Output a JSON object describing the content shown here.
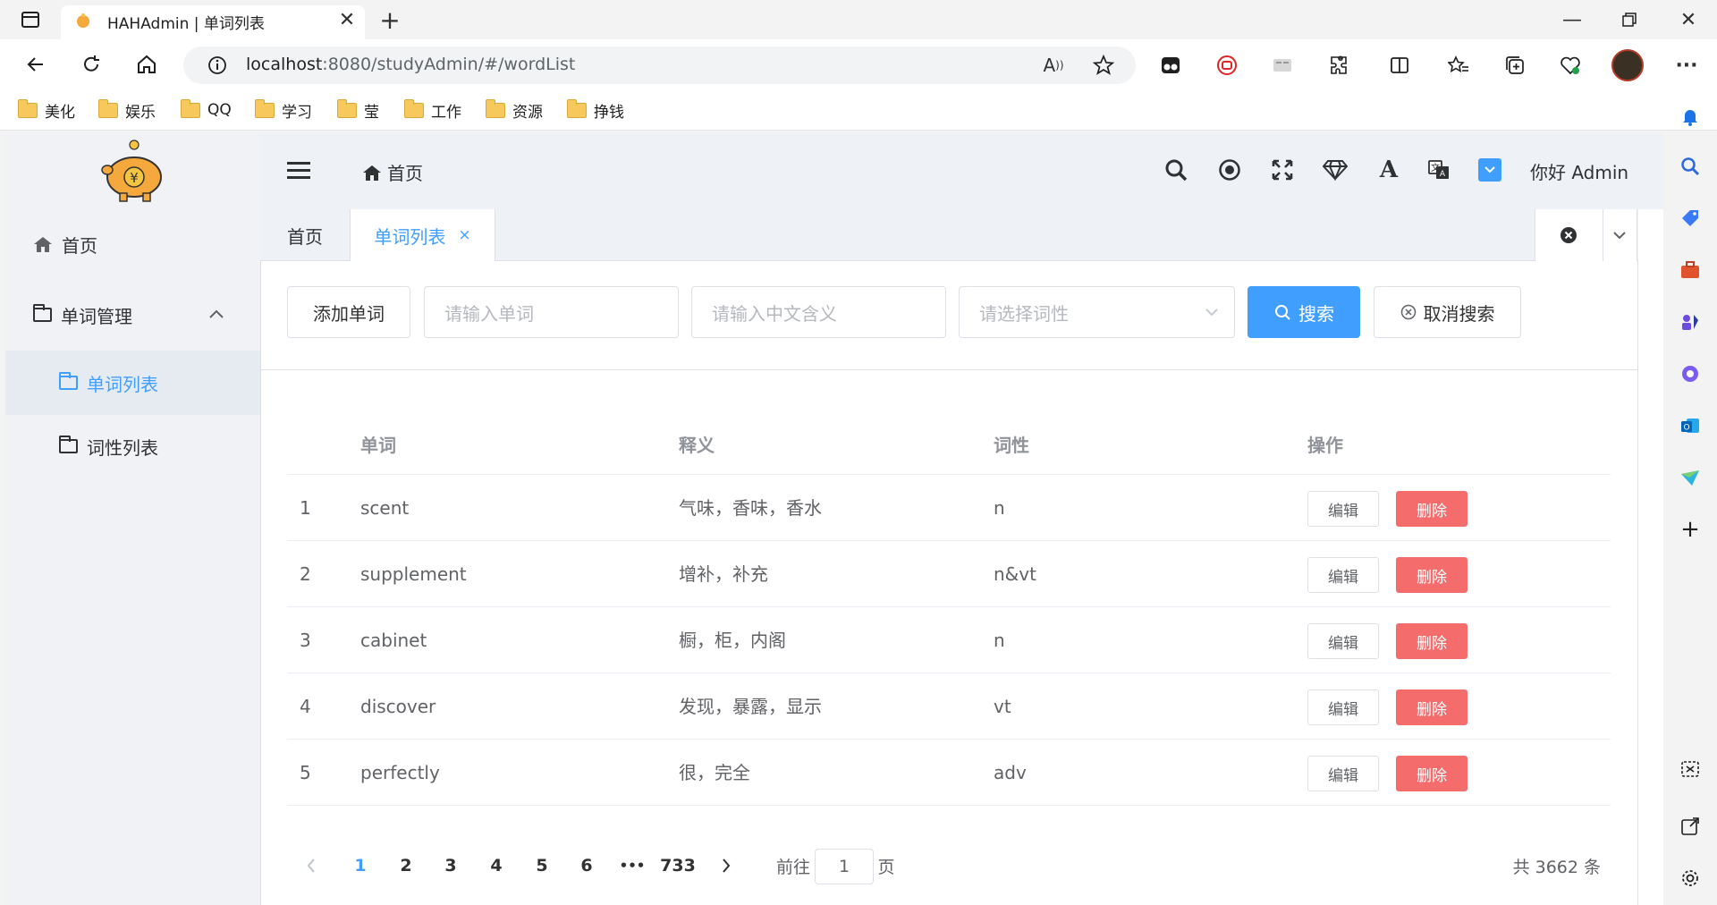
{
  "browser": {
    "tab_title": "HAHAdmin | 单词列表",
    "url_host": "localhost",
    "url_rest": ":8080/studyAdmin/#/wordList",
    "bookmarks": [
      "美化",
      "娱乐",
      "QQ",
      "学习",
      "莹",
      "工作",
      "资源",
      "挣钱"
    ]
  },
  "sidebar": {
    "logo_icon": "piggy-bank-icon",
    "items": [
      {
        "label": "首页",
        "icon": "home-icon"
      },
      {
        "label": "单词管理",
        "icon": "folder-icon"
      },
      {
        "label": "单词列表",
        "icon": "folder-icon",
        "active": true
      },
      {
        "label": "词性列表",
        "icon": "folder-icon"
      }
    ]
  },
  "header": {
    "breadcrumb": "首页",
    "greeting": "你好 Admin"
  },
  "tabs": [
    {
      "label": "首页"
    },
    {
      "label": "单词列表",
      "close": "×",
      "active": true
    }
  ],
  "filters": {
    "add_button": "添加单词",
    "word_placeholder": "请输入单词",
    "meaning_placeholder": "请输入中文含义",
    "pos_placeholder": "请选择词性",
    "search_button": "搜索",
    "cancel_button": "取消搜索"
  },
  "table": {
    "columns": [
      "单词",
      "释义",
      "词性",
      "操作"
    ],
    "rows": [
      {
        "index": "1",
        "word": "scent",
        "meaning": "气味，香味，香水",
        "pos": "n"
      },
      {
        "index": "2",
        "word": "supplement",
        "meaning": "增补，补充",
        "pos": "n&vt"
      },
      {
        "index": "3",
        "word": "cabinet",
        "meaning": "橱，柜，内阁",
        "pos": "n"
      },
      {
        "index": "4",
        "word": "discover",
        "meaning": "发现，暴露，显示",
        "pos": "vt"
      },
      {
        "index": "5",
        "word": "perfectly",
        "meaning": "很，完全",
        "pos": "adv"
      }
    ],
    "edit_label": "编辑",
    "delete_label": "删除"
  },
  "pagination": {
    "pages": [
      "1",
      "2",
      "3",
      "4",
      "5",
      "6"
    ],
    "ellipsis": "•••",
    "last_page": "733",
    "current": "1",
    "goto_prefix": "前往",
    "goto_value": "1",
    "goto_suffix": "页",
    "total": "共 3662 条"
  },
  "colors": {
    "primary": "#409eff",
    "danger": "#f56c6c",
    "sidebar_bg": "#f0f2f5"
  }
}
